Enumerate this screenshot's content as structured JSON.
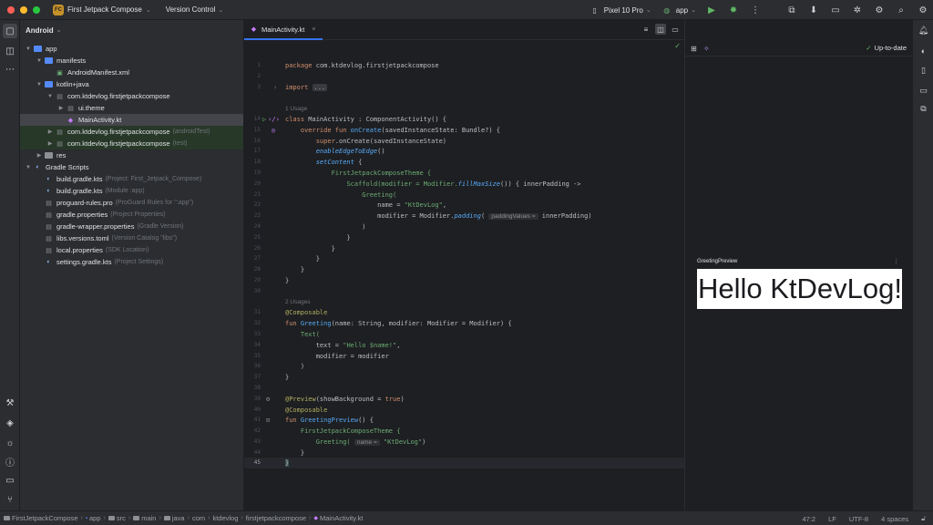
{
  "titlebar": {
    "project_badge": "FC",
    "project_name": "First Jetpack Compose",
    "vcs_label": "Version Control",
    "device": "Pixel 10 Pro",
    "run_config": "app"
  },
  "project_panel": {
    "view_mode": "Android",
    "tree": [
      {
        "label": "app",
        "hint": "",
        "icon": "module-folder-icon"
      },
      {
        "label": "manifests",
        "hint": "",
        "icon": "folder-icon"
      },
      {
        "label": "AndroidManifest.xml",
        "hint": "",
        "icon": "xml-file-icon"
      },
      {
        "label": "kotlin+java",
        "hint": "",
        "icon": "folder-icon"
      },
      {
        "label": "com.ktdevlog.firstjetpackcompose",
        "hint": "",
        "icon": "package-icon"
      },
      {
        "label": "ui.theme",
        "hint": "",
        "icon": "package-icon"
      },
      {
        "label": "MainActivity.kt",
        "hint": "",
        "icon": "kotlin-file-icon"
      },
      {
        "label": "com.ktdevlog.firstjetpackcompose",
        "hint": "(androidTest)",
        "icon": "package-icon"
      },
      {
        "label": "com.ktdevlog.firstjetpackcompose",
        "hint": "(test)",
        "icon": "package-icon"
      },
      {
        "label": "res",
        "hint": "",
        "icon": "res-folder-icon"
      },
      {
        "label": "Gradle Scripts",
        "hint": "",
        "icon": "gradle-icon"
      },
      {
        "label": "build.gradle.kts",
        "hint": "(Project: First_Jetpack_Compose)",
        "icon": "gradle-file-icon"
      },
      {
        "label": "build.gradle.kts",
        "hint": "(Module :app)",
        "icon": "gradle-file-icon"
      },
      {
        "label": "proguard-rules.pro",
        "hint": "(ProGuard Rules for \":app\")",
        "icon": "file-icon"
      },
      {
        "label": "gradle.properties",
        "hint": "(Project Properties)",
        "icon": "file-icon"
      },
      {
        "label": "gradle-wrapper.properties",
        "hint": "(Gradle Version)",
        "icon": "file-icon"
      },
      {
        "label": "libs.versions.toml",
        "hint": "(Version Catalog \"libs\")",
        "icon": "file-icon"
      },
      {
        "label": "local.properties",
        "hint": "(SDK Location)",
        "icon": "file-icon"
      },
      {
        "label": "settings.gradle.kts",
        "hint": "(Project Settings)",
        "icon": "gradle-file-icon"
      }
    ]
  },
  "editor": {
    "tab_label": "MainActivity.kt",
    "line_numbers": [
      "1",
      "2",
      "3",
      "14",
      "15",
      "16",
      "17",
      "18",
      "19",
      "20",
      "21",
      "22",
      "23",
      "24",
      "25",
      "26",
      "27",
      "28",
      "29",
      "30",
      "31",
      "32",
      "33",
      "34",
      "35",
      "36",
      "37",
      "38",
      "39",
      "40",
      "41",
      "42",
      "43",
      "44",
      "45",
      "46",
      "47"
    ],
    "usages": [
      "1 Usage",
      "2 Usages"
    ],
    "tokens": {
      "package_kw": "package",
      "package_name": " com.ktdevlog.firstjetpackcompose",
      "import_kw": "import",
      "import_fold": "...",
      "class_kw": "class",
      "class_decl": " MainActivity : ComponentActivity() {",
      "override_kw": "override fun",
      "oncreate_fn": "onCreate",
      "oncreate_params": "(savedInstanceState: Bundle?) {",
      "super_kw": "super",
      "super_call": ".onCreate(savedInstanceState)",
      "edge_call": "enableEdgeToEdge",
      "edge_tail": "()",
      "setcontent_call": "setContent",
      "setcontent_tail": " {",
      "theme_call": "FirstJetpackComposeTheme {",
      "scaffold_head": "Scaffold(modifier = Modifier.",
      "fill_call": "fillMaxSize",
      "scaffold_tail": "()) { innerPadding ->",
      "greeting_open": "Greeting(",
      "name_arg": "name = ",
      "name_str": "\"KtDevLog\"",
      "comma": ",",
      "modifier_head": "modifier = Modifier.",
      "padding_call": "padding",
      "paren_open": "(",
      "padding_hint": "paddingValues =",
      "padding_tail": " innerPadding)",
      "close_paren": ")",
      "close_brace": "}",
      "composable_ann": "@Composable",
      "fun_kw": "fun",
      "greeting_fn": "Greeting",
      "greeting_params": "(name: String, modifier: Modifier = Modifier) {",
      "text_call": "Text(",
      "text_arg": "text = ",
      "text_str": "\"Hello $name!\"",
      "modifier_arg": "modifier = modifier",
      "preview_ann": "@Preview",
      "preview_args_head": "(showBackground = ",
      "true_kw": "true",
      "greetingpreview_fn": "GreetingPreview",
      "greetingpreview_params": "() {",
      "greeting_call2": "Greeting(",
      "name_hint": "name =",
      "ktdevlog_str": "\"KtDevLog\""
    }
  },
  "preview": {
    "status": "Up-to-date",
    "card_title": "GreetingPreview",
    "rendered_text": "Hello KtDevLog!"
  },
  "statusbar": {
    "breadcrumbs": [
      "FirstJetpackCompose",
      "app",
      "src",
      "main",
      "java",
      "com",
      "ktdevlog",
      "firstjetpackcompose",
      "MainActivity.kt"
    ],
    "caret": "47:2",
    "line_sep": "LF",
    "encoding": "UTF-8",
    "indent": "4 spaces"
  }
}
